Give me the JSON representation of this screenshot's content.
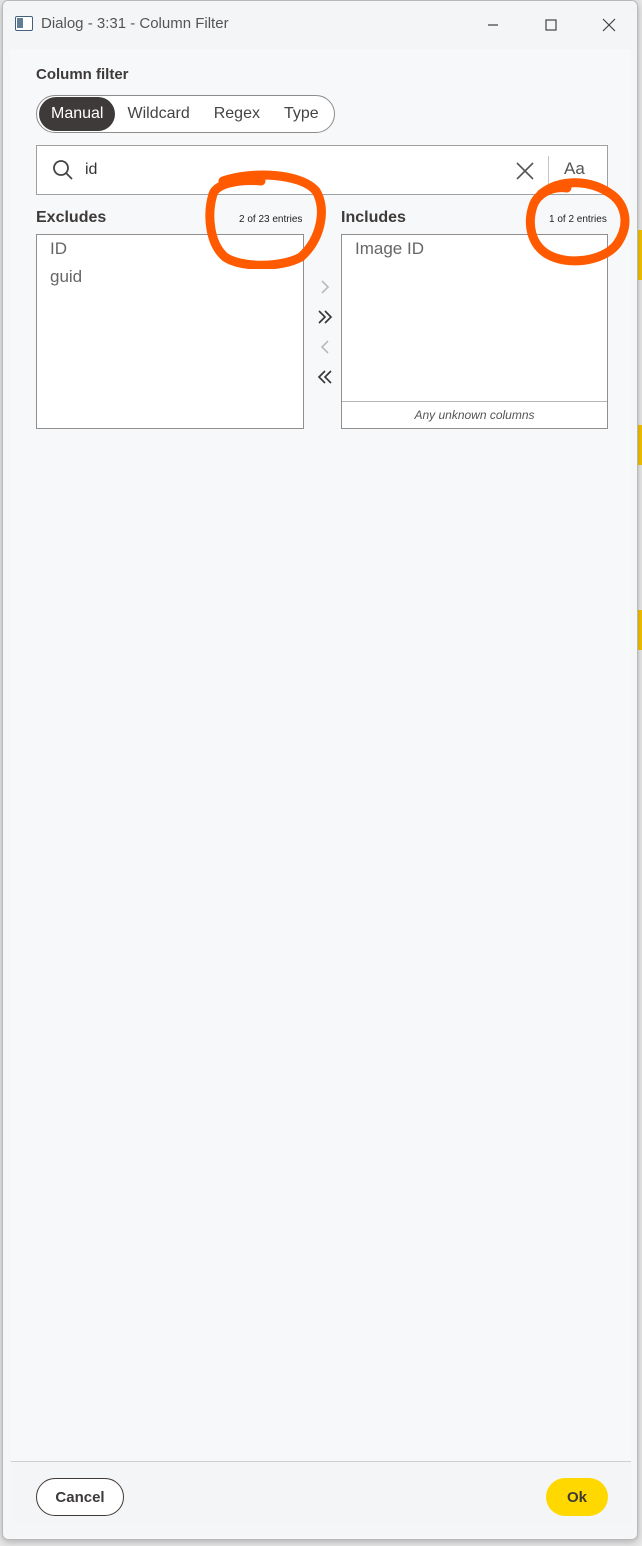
{
  "window": {
    "title": "Dialog - 3:31 - Column Filter"
  },
  "filter": {
    "label": "Column filter",
    "modes": [
      "Manual",
      "Wildcard",
      "Regex",
      "Type"
    ],
    "active_mode": "Manual"
  },
  "search": {
    "value": "id",
    "case_toggle": "Aa"
  },
  "excludes": {
    "label": "Excludes",
    "count": "2 of 23 entries",
    "items": [
      "ID",
      "guid"
    ]
  },
  "includes": {
    "label": "Includes",
    "count": "1 of 2 entries",
    "items": [
      "Image ID"
    ],
    "unknown_label": "Any unknown columns"
  },
  "footer": {
    "cancel_label": "Cancel",
    "ok_label": "Ok"
  },
  "colors": {
    "accent": "#ffd800",
    "dark": "#3e3a39",
    "annotation": "#ff5a00"
  },
  "icons": [
    "app-icon",
    "minimize-icon",
    "maximize-icon",
    "close-icon",
    "search-icon",
    "clear-icon",
    "move-right-icon",
    "move-all-right-icon",
    "move-left-icon",
    "move-all-left-icon"
  ]
}
